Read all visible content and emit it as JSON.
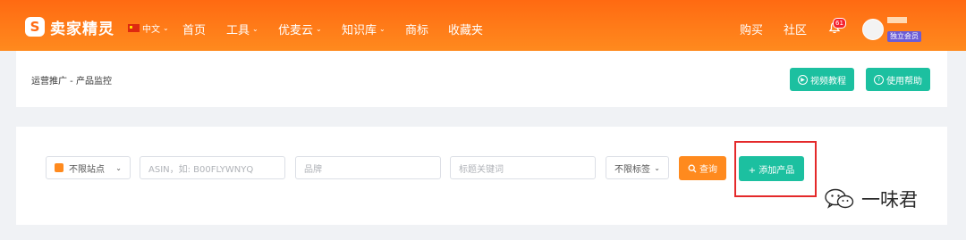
{
  "header": {
    "logo_text": "卖家精灵",
    "logo_mark": "S",
    "language": "中文",
    "nav": [
      {
        "label": "首页"
      },
      {
        "label": "工具"
      },
      {
        "label": "优麦云"
      },
      {
        "label": "知识库"
      },
      {
        "label": "商标"
      },
      {
        "label": "收藏夹"
      }
    ],
    "buy": "购买",
    "community": "社区",
    "notification_count": "61",
    "member_tag": "独立会员"
  },
  "page": {
    "breadcrumb": "运营推广 - 产品监控",
    "video_tutorial": "视频教程",
    "help": "使用帮助"
  },
  "filters": {
    "site": "不限站点",
    "asin_placeholder": "ASIN，如: B00FLYWNYQ",
    "brand_placeholder": "品牌",
    "keyword_placeholder": "标题关键词",
    "tag": "不限标签",
    "search": "查询",
    "add_product": "+ 添加产品"
  },
  "watermark": {
    "text": "一味君"
  },
  "colors": {
    "brand_orange": "#ff7a18",
    "accent_green": "#1cc0a0",
    "highlight_red": "#e4292a"
  }
}
